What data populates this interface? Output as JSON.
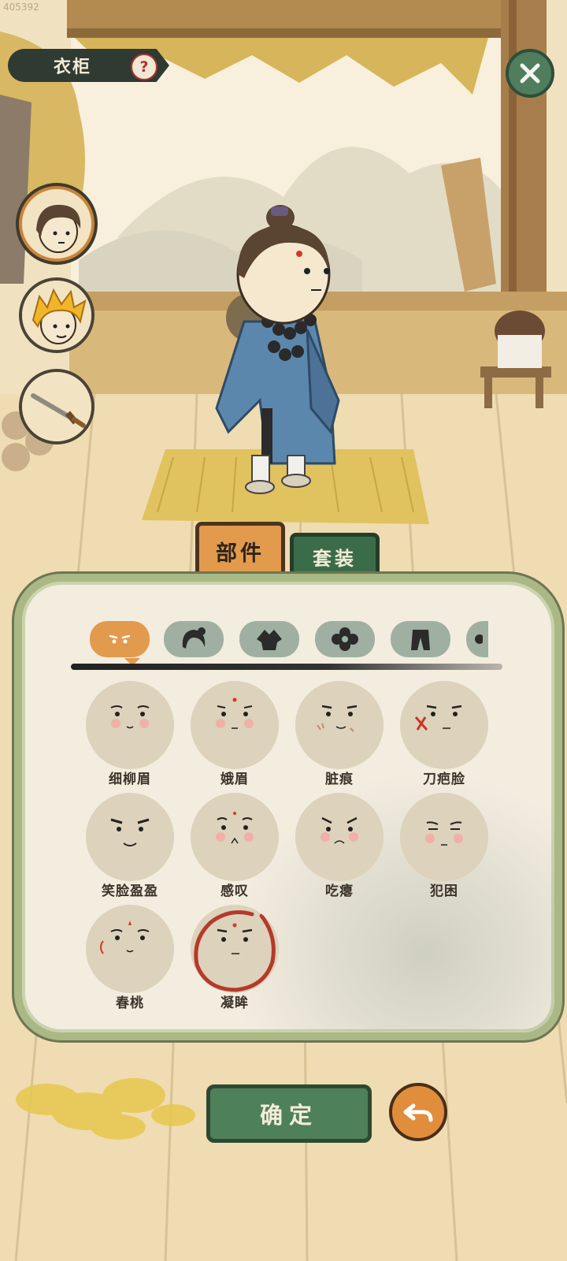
{
  "build_id": "405392",
  "header": {
    "title": "衣柜",
    "help_icon": "question-icon",
    "close_icon": "close-icon"
  },
  "side_buttons": [
    {
      "name": "character-brown-hair",
      "active": true
    },
    {
      "name": "character-golden-hair",
      "active": false
    },
    {
      "name": "sword-item",
      "active": false
    }
  ],
  "tabs": {
    "parts": "部件",
    "sets": "套装"
  },
  "categories": [
    "face",
    "hair",
    "clothing",
    "flower",
    "pants",
    "more"
  ],
  "faces": [
    {
      "label": "细柳眉"
    },
    {
      "label": "娥眉"
    },
    {
      "label": "脏痕"
    },
    {
      "label": "刀疤脸"
    },
    {
      "label": "笑脸盈盈"
    },
    {
      "label": "感叹"
    },
    {
      "label": "吃瘪"
    },
    {
      "label": "犯困"
    },
    {
      "label": "春桃"
    },
    {
      "label": "凝眸",
      "selected": true
    }
  ],
  "footer": {
    "confirm_label": "确定",
    "undo_icon": "undo-icon"
  },
  "colors": {
    "accent_orange": "#e29a4d",
    "accent_green": "#4e8059",
    "selected_ring": "#b43a2b"
  }
}
